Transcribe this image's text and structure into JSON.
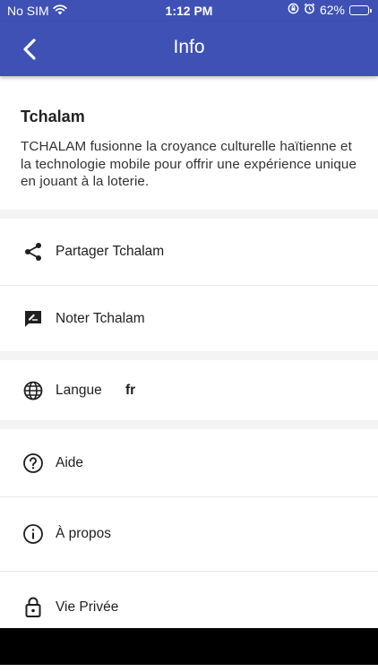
{
  "status_bar": {
    "carrier": "No SIM",
    "time": "1:12 PM",
    "battery": "62%",
    "battery_level": 0.62
  },
  "app_bar": {
    "title": "Info",
    "back_icon": "chevron-left-icon"
  },
  "intro": {
    "title": "Tchalam",
    "description": "TCHALAM fusionne la croyance culturelle haïtienne et la technologie mobile pour offrir une expérience unique en jouant à la loterie."
  },
  "menu": {
    "share": {
      "label": "Partager Tchalam",
      "icon": "share-icon"
    },
    "rate": {
      "label": "Noter Tchalam",
      "icon": "rate-review-icon"
    },
    "language": {
      "label": "Langue",
      "value": "fr",
      "icon": "globe-icon"
    },
    "help": {
      "label": "Aide",
      "icon": "help-circle-icon"
    },
    "about": {
      "label": "À propos",
      "icon": "info-circle-icon"
    },
    "privacy": {
      "label": "Vie Privée",
      "icon": "lock-icon"
    }
  },
  "colors": {
    "primary": "#3f51b5",
    "background": "#ffffff",
    "section_gap": "#f4f4f4"
  }
}
